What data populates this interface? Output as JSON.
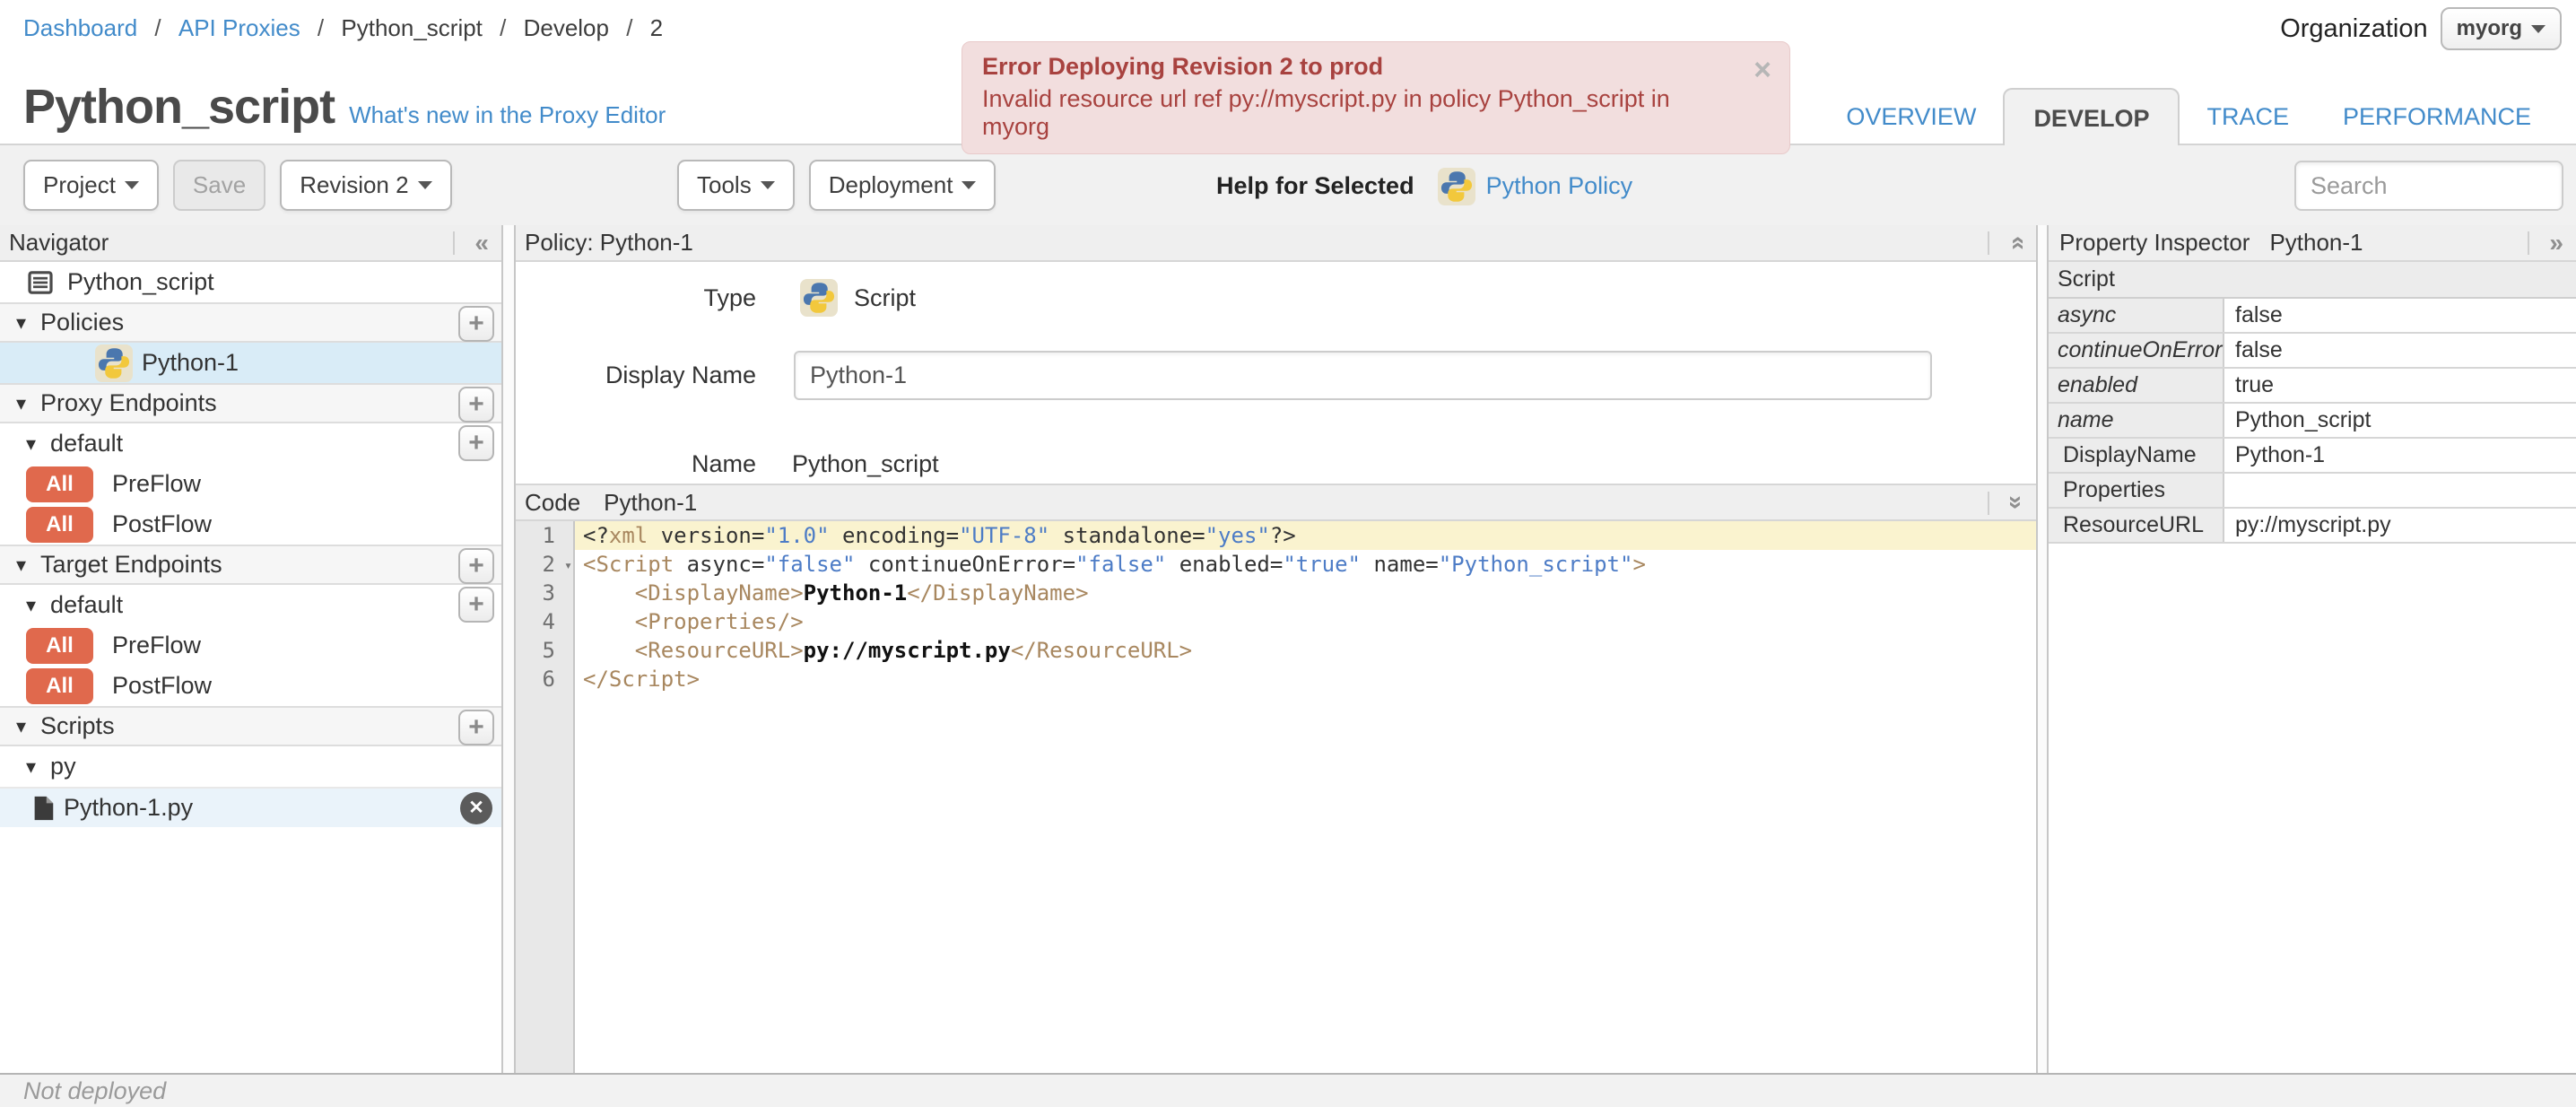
{
  "colors": {
    "accent_blue": "#428bca",
    "error_bg": "#f2dede",
    "error_text": "#a8423f",
    "badge_red": "#e0694d",
    "selected_row": "#d9ecf7",
    "active_line": "#faf3cf",
    "code_tag": "#a8875f",
    "code_string": "#4d7cc6"
  },
  "icons": {
    "collapse_left": "«",
    "collapse_right": "»",
    "caret_down": "▾",
    "close": "×",
    "delete": "✕",
    "plus": "+"
  },
  "breadcrumb": {
    "separator": "/",
    "items": [
      {
        "label": "Dashboard",
        "link": true
      },
      {
        "label": "API Proxies",
        "link": true
      },
      {
        "label": "Python_script",
        "link": false
      },
      {
        "label": "Develop",
        "link": false
      },
      {
        "label": "2",
        "link": false
      }
    ]
  },
  "organization": {
    "label": "Organization",
    "value": "myorg"
  },
  "error_banner": {
    "title": "Error Deploying Revision 2 to prod",
    "message": "Invalid resource url ref py://myscript.py in policy Python_script in myorg"
  },
  "page": {
    "title": "Python_script",
    "whats_new": "What's new in the Proxy Editor"
  },
  "tabs": [
    {
      "label": "OVERVIEW",
      "active": false
    },
    {
      "label": "DEVELOP",
      "active": true
    },
    {
      "label": "TRACE",
      "active": false
    },
    {
      "label": "PERFORMANCE",
      "active": false
    }
  ],
  "toolbar": {
    "project": "Project",
    "save": "Save",
    "revision": "Revision 2",
    "tools": "Tools",
    "deployment": "Deployment",
    "help_for_selected": "Help for Selected",
    "policy_link": "Python Policy",
    "search_placeholder": "Search"
  },
  "navigator": {
    "title": "Navigator",
    "rows": [
      {
        "kind": "root",
        "label": "Python_script",
        "icon": "proxy-icon"
      },
      {
        "kind": "section",
        "label": "Policies",
        "add": true
      },
      {
        "kind": "policy",
        "label": "Python-1",
        "icon": "python-icon",
        "selected": true
      },
      {
        "kind": "section",
        "label": "Proxy Endpoints",
        "add": true
      },
      {
        "kind": "endpoint",
        "label": "default",
        "add": true
      },
      {
        "kind": "flow",
        "label": "PreFlow",
        "badge": "All"
      },
      {
        "kind": "flow",
        "label": "PostFlow",
        "badge": "All"
      },
      {
        "kind": "section",
        "label": "Target Endpoints",
        "add": true
      },
      {
        "kind": "endpoint",
        "label": "default",
        "add": true
      },
      {
        "kind": "flow",
        "label": "PreFlow",
        "badge": "All"
      },
      {
        "kind": "flow",
        "label": "PostFlow",
        "badge": "All"
      },
      {
        "kind": "section",
        "label": "Scripts",
        "add": true
      },
      {
        "kind": "folder",
        "label": "py"
      },
      {
        "kind": "file",
        "label": "Python-1.py",
        "icon": "file-icon",
        "selected": true,
        "delete": true
      }
    ]
  },
  "policy_panel": {
    "header": "Policy: Python-1",
    "type_label": "Type",
    "type_value": "Script",
    "display_name_label": "Display Name",
    "display_name_value": "Python-1",
    "name_label": "Name",
    "name_value": "Python_script"
  },
  "code_panel": {
    "header_label": "Code",
    "header_file": "Python-1",
    "lines": [
      {
        "num": 1,
        "active": true,
        "fold": false,
        "tokens": [
          [
            "p",
            "<?"
          ],
          [
            "tag",
            "xml"
          ],
          [
            "p",
            " version="
          ],
          [
            "str",
            "\"1.0\""
          ],
          [
            "p",
            " encoding="
          ],
          [
            "str",
            "\"UTF-8\""
          ],
          [
            "p",
            " standalone="
          ],
          [
            "str",
            "\"yes\""
          ],
          [
            "p",
            "?>"
          ]
        ]
      },
      {
        "num": 2,
        "active": false,
        "fold": true,
        "tokens": [
          [
            "tag",
            "<Script"
          ],
          [
            "p",
            " async="
          ],
          [
            "str",
            "\"false\""
          ],
          [
            "p",
            " continueOnError="
          ],
          [
            "str",
            "\"false\""
          ],
          [
            "p",
            " enabled="
          ],
          [
            "str",
            "\"true\""
          ],
          [
            "p",
            " name="
          ],
          [
            "str",
            "\"Python_script\""
          ],
          [
            "tag",
            ">"
          ]
        ]
      },
      {
        "num": 3,
        "active": false,
        "fold": false,
        "tokens": [
          [
            "p",
            "    "
          ],
          [
            "tag",
            "<DisplayName>"
          ],
          [
            "txt",
            "Python-1"
          ],
          [
            "tag",
            "</DisplayName>"
          ]
        ]
      },
      {
        "num": 4,
        "active": false,
        "fold": false,
        "tokens": [
          [
            "p",
            "    "
          ],
          [
            "tag",
            "<Properties/>"
          ]
        ]
      },
      {
        "num": 5,
        "active": false,
        "fold": false,
        "tokens": [
          [
            "p",
            "    "
          ],
          [
            "tag",
            "<ResourceURL>"
          ],
          [
            "txt",
            "py://myscript.py"
          ],
          [
            "tag",
            "</ResourceURL>"
          ]
        ]
      },
      {
        "num": 6,
        "active": false,
        "fold": false,
        "tokens": [
          [
            "tag",
            "</Script>"
          ]
        ]
      }
    ]
  },
  "property_inspector": {
    "header": "Property Inspector",
    "subject": "Python-1",
    "group": "Script",
    "rows": [
      {
        "key": "async",
        "value": "false",
        "italic": true
      },
      {
        "key": "continueOnError",
        "value": "false",
        "italic": true
      },
      {
        "key": "enabled",
        "value": "true",
        "italic": true
      },
      {
        "key": "name",
        "value": "Python_script",
        "italic": true
      },
      {
        "key": "DisplayName",
        "value": "Python-1",
        "italic": false
      },
      {
        "key": "Properties",
        "value": "",
        "italic": false
      },
      {
        "key": "ResourceURL",
        "value": "py://myscript.py",
        "italic": false
      }
    ]
  },
  "status_bar": {
    "text": "Not deployed"
  }
}
